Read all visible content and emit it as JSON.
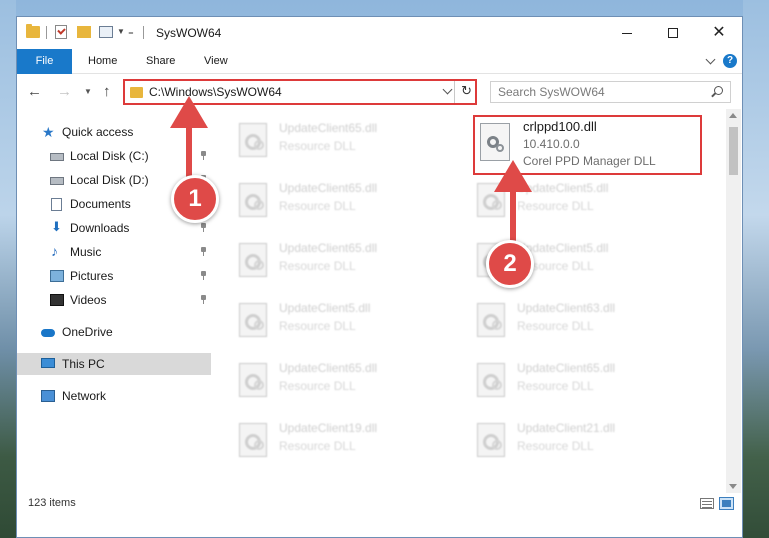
{
  "window": {
    "title": "SysWOW64"
  },
  "ribbon": {
    "tabs": [
      "File",
      "Home",
      "Share",
      "View"
    ],
    "help_label": "?"
  },
  "navbar": {
    "address": "C:\\Windows\\SysWOW64",
    "search_placeholder": "Search SysWOW64"
  },
  "sidebar": {
    "items": [
      {
        "label": "Quick access",
        "icon": "star-icon"
      },
      {
        "label": "Local Disk (C:)",
        "icon": "drive-icon",
        "pinned": true
      },
      {
        "label": "Local Disk (D:)",
        "icon": "drive-icon",
        "pinned": true
      },
      {
        "label": "Documents",
        "icon": "document-icon",
        "pinned": true
      },
      {
        "label": "Downloads",
        "icon": "download-icon",
        "pinned": true
      },
      {
        "label": "Music",
        "icon": "music-icon",
        "pinned": true
      },
      {
        "label": "Pictures",
        "icon": "pictures-icon",
        "pinned": true
      },
      {
        "label": "Videos",
        "icon": "videos-icon",
        "pinned": true
      },
      {
        "label": "OneDrive",
        "icon": "cloud-icon"
      },
      {
        "label": "This PC",
        "icon": "computer-icon",
        "selected": true
      },
      {
        "label": "Network",
        "icon": "network-icon"
      }
    ]
  },
  "files": {
    "left_column": [
      {
        "name": "UpdateClient65.dll",
        "type": "Resource DLL"
      },
      {
        "name": "UpdateClient65.dll",
        "type": "Resource DLL"
      },
      {
        "name": "UpdateClient65.dll",
        "type": "Resource DLL"
      },
      {
        "name": "UpdateClient5.dll",
        "type": "Resource DLL"
      },
      {
        "name": "UpdateClient65.dll",
        "type": "Resource DLL"
      },
      {
        "name": "UpdateClient19.dll",
        "type": "Resource DLL"
      }
    ],
    "right_column": [
      {
        "name": "UpdateClient5.dll",
        "type": "Resource DLL"
      },
      {
        "name": "UpdateClient5.dll",
        "type": "Resource DLL"
      },
      {
        "name": "UpdateClient63.dll",
        "type": "Resource DLL"
      },
      {
        "name": "UpdateClient65.dll",
        "type": "Resource DLL"
      },
      {
        "name": "UpdateClient21.dll",
        "type": "Resource DLL"
      }
    ],
    "highlighted": {
      "name": "crlppd100.dll",
      "version": "10.410.0.0",
      "description": "Corel PPD Manager DLL"
    }
  },
  "status": {
    "item_count": "123 items"
  },
  "callouts": {
    "one": "1",
    "two": "2"
  },
  "colors": {
    "accent": "#1979ca",
    "highlight": "#dd3a3a",
    "callout": "#df4a48"
  }
}
